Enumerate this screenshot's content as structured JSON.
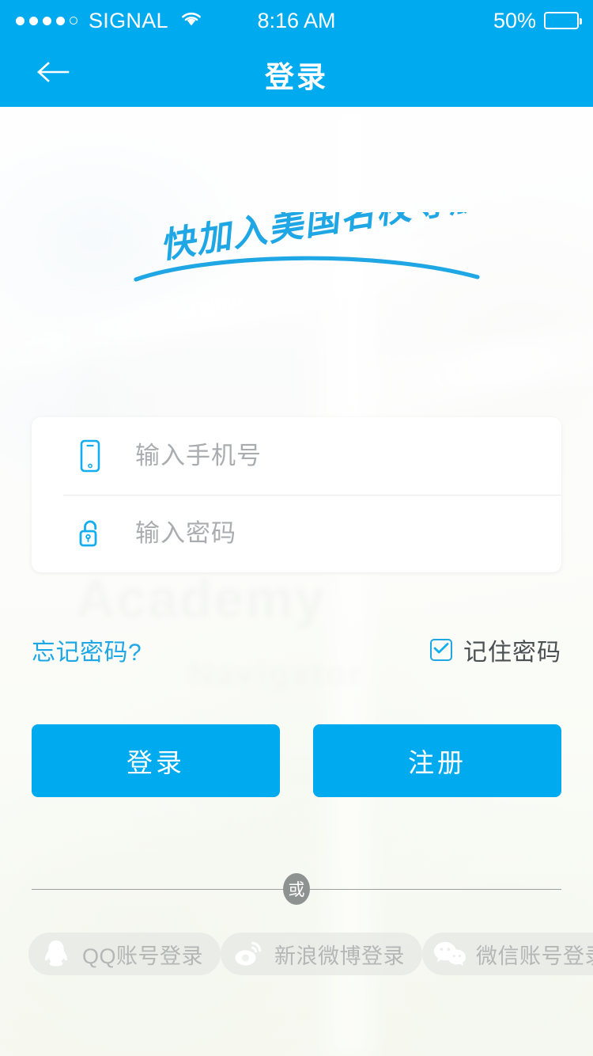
{
  "theme": {
    "accent": "#00AAEE",
    "link_blue": "#1EA7E4",
    "button_blue": "#00AAEE",
    "placeholder_gray": "#a9adb0",
    "social_gray": "#b3b7b5",
    "divider_gray": "#8e9392"
  },
  "status_bar": {
    "signal_dots_filled": 4,
    "signal_dots_total": 5,
    "carrier": "SIGNAL",
    "wifi_icon": "wifi-icon",
    "time": "8:16 AM",
    "battery_percent": "50%",
    "battery_level": 50
  },
  "nav": {
    "back_icon": "arrow-left-icon",
    "title": "登录"
  },
  "headline": {
    "text": "快加入美国名校导航!",
    "style": "handwritten-script",
    "underline": "curved-swoosh"
  },
  "background": {
    "ghost_word": "Academy",
    "ghost_word_secondary": "Navigator"
  },
  "form": {
    "phone": {
      "icon": "mobile-phone-icon",
      "placeholder": "输入手机号",
      "value": ""
    },
    "password": {
      "icon": "unlocked-padlock-icon",
      "placeholder": "输入密码",
      "value": ""
    }
  },
  "options": {
    "forgot_password": "忘记密码?",
    "remember_password": "记住密码",
    "remember_checked": true,
    "check_icon": "checkmark-icon"
  },
  "actions": {
    "login": "登录",
    "register": "注册"
  },
  "divider": {
    "label": "或"
  },
  "social": [
    {
      "id": "qq",
      "icon": "qq-penguin-icon",
      "label": "QQ账号登录"
    },
    {
      "id": "weibo",
      "icon": "sina-weibo-eye-icon",
      "label": "新浪微博登录"
    },
    {
      "id": "wechat",
      "icon": "wechat-bubbles-icon",
      "label": "微信账号登录"
    }
  ]
}
